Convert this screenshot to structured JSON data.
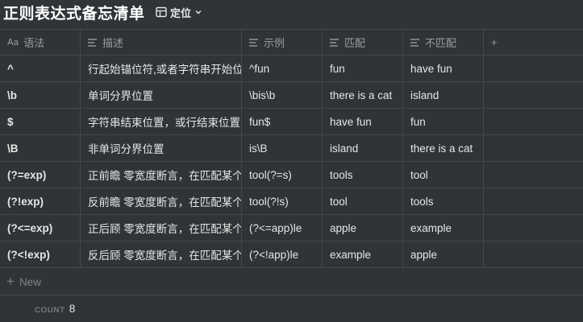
{
  "page": {
    "title": "正则表达式备忘清单",
    "view_name": "定位"
  },
  "table": {
    "columns": [
      {
        "label": "语法",
        "icon": "title-icon"
      },
      {
        "label": "描述",
        "icon": "text-icon"
      },
      {
        "label": "示例",
        "icon": "text-icon"
      },
      {
        "label": "匹配",
        "icon": "text-icon"
      },
      {
        "label": "不匹配",
        "icon": "text-icon"
      }
    ],
    "add_column_label": "+",
    "rows": [
      {
        "syntax": "^",
        "desc": "行起始锚位符,或者字符串开始位置",
        "example": "^fun",
        "match": "fun",
        "nomatch": "have fun"
      },
      {
        "syntax": "\\b",
        "desc": "单词分界位置",
        "example": "\\bis\\b",
        "match": "there is a cat",
        "nomatch": "island"
      },
      {
        "syntax": "$",
        "desc": "字符串结束位置，或行结束位置",
        "example": "fun$",
        "match": "have fun",
        "nomatch": "fun"
      },
      {
        "syntax": "\\B",
        "desc": "非单词分界位置",
        "example": "is\\B",
        "match": "island",
        "nomatch": "there is a cat"
      },
      {
        "syntax": "(?=exp)",
        "desc": "正前瞻 零宽度断言，在匹配某个",
        "example": "tool(?=s)",
        "match": "tools",
        "nomatch": "tool"
      },
      {
        "syntax": "(?!exp)",
        "desc": "反前瞻 零宽度断言，在匹配某个",
        "example": "tool(?!s)",
        "match": "tool",
        "nomatch": "tools"
      },
      {
        "syntax": "(?<=exp)",
        "desc": "正后顾 零宽度断言，在匹配某个",
        "example": "(?<=app)le",
        "match": "apple",
        "nomatch": "example"
      },
      {
        "syntax": "(?<!exp)",
        "desc": "反后顾 零宽度断言，在匹配某个",
        "example": "(?<!app)le",
        "match": "example",
        "nomatch": "apple"
      }
    ],
    "new_label": "New"
  },
  "footer": {
    "count_label": "COUNT",
    "count_value": "8"
  },
  "colors": {
    "background": "#2f3437",
    "border": "#43484b",
    "muted_text": "#9b9c9d",
    "text": "#e6e6e5"
  }
}
